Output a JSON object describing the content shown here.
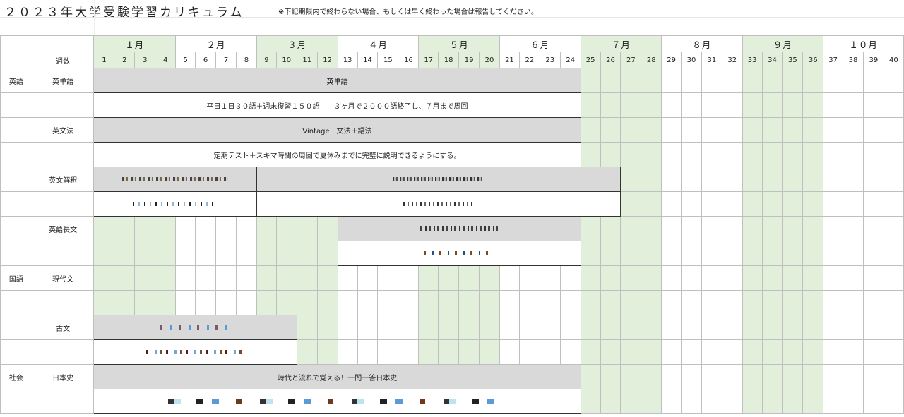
{
  "header": {
    "title": "２０２３年大学受験学習カリキュラム",
    "note": "※下記期限内で終わらない場合、もしくは早く終わった場合は報告してください。"
  },
  "table": {
    "weeks_label": "週数",
    "months": [
      "１月",
      "２月",
      "３月",
      "４月",
      "５月",
      "６月",
      "７月",
      "８月",
      "９月",
      "１０月"
    ],
    "weeks": [
      "1",
      "2",
      "3",
      "4",
      "5",
      "6",
      "7",
      "8",
      "9",
      "10",
      "11",
      "12",
      "13",
      "14",
      "15",
      "16",
      "17",
      "18",
      "19",
      "20",
      "21",
      "22",
      "23",
      "24",
      "25",
      "26",
      "27",
      "28",
      "29",
      "30",
      "31",
      "32",
      "33",
      "34",
      "35",
      "36",
      "37",
      "38",
      "39",
      "40"
    ],
    "subjects": {
      "english": "英語",
      "japanese": "国語",
      "social": "社会"
    },
    "rows": {
      "vocab": {
        "label": "英単語",
        "bar": "英単語",
        "detail": "平日１日３０語＋週末復習１５０語　　３ヶ月で２０００語終了し、７月まで周回"
      },
      "grammar": {
        "label": "英文法",
        "bar": "Vintage　文法＋語法",
        "detail": "定期テスト＋スキマ時間の周回で夏休みまでに完璧に説明できるようにする。"
      },
      "interpretation": {
        "label": "英文解釈"
      },
      "long_reading": {
        "label": "英語長文"
      },
      "modern": {
        "label": "現代文"
      },
      "classic": {
        "label": "古文"
      },
      "history": {
        "label": "日本史",
        "bar": "時代と流れで覚える！一問一答日本史"
      }
    }
  },
  "colors": {
    "month_highlight": "#e2efda",
    "bar_fill": "#d9d9d9",
    "border": "#bfbfbf"
  }
}
